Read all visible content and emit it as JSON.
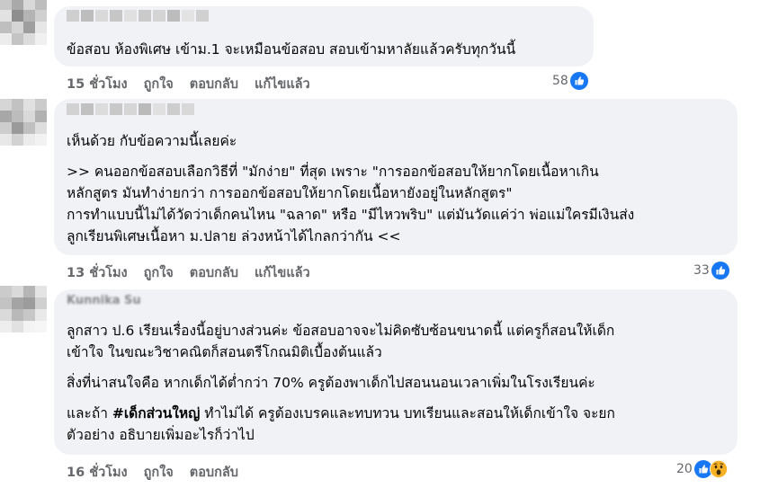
{
  "comments": [
    {
      "lines": [
        "ข้อสอบ ห้องพิเศษ เข้าม.1 จะเหมือนข้อสอบ สอบเข้ามหาลัยแล้วครับทุกวันนี้"
      ],
      "time": "15 ชั่วโมง",
      "like": "ถูกใจ",
      "reply": "ตอบกลับ",
      "edited": "แก้ไขแล้ว",
      "reaction_count": "58",
      "reaction_icons": [
        "like-icon"
      ]
    },
    {
      "lines": [
        "เห็นด้วย กับข้อความนี้เลยค่ะ",
        "",
        ">> คนออกข้อสอบเลือกวิธีที่ \"มักง่าย\" ที่สุด เพราะ \"การออกข้อสอบให้ยากโดยเนื้อหาเกิน",
        "หลักสูตร มันทำง่ายกว่า การออกข้อสอบให้ยากโดยเนื้อหายังอยู่ในหลักสูตร\"",
        "การทำแบบนี้ไม่ได้วัดว่าเด็กคนไหน \"ฉลาด\" หรือ \"มีไหวพริบ\" แต่มันวัดแค่ว่า พ่อแม่ใครมีเงินส่ง",
        "ลูกเรียนพิเศษเนื้อหา ม.ปลาย ล่วงหน้าได้ไกลกว่ากัน <<"
      ],
      "time": "13 ชั่วโมง",
      "like": "ถูกใจ",
      "reply": "ตอบกลับ",
      "edited": "แก้ไขแล้ว",
      "reaction_count": "33",
      "reaction_icons": [
        "like-icon"
      ]
    },
    {
      "author_peek": "Kunnika Su",
      "lines": [
        "ลูกสาว ป.6 เรียนเรื่องนี้อยู่บางส่วนค่ะ ข้อสอบอาจจะไม่คิดซับซ้อนขนาดนี้ แต่ครูก็สอนให้เด็ก",
        "เข้าใจ ในขณะวิชาคณิตก็สอนตรีโกณมิติเบื้องต้นแล้ว",
        "",
        "สิ่งที่น่าสนใจคือ หากเด็กได้ต่ำกว่า 70% ครูต้องพาเด็กไปสอนนอนเวลาเพิ่มในโรงเรียนค่ะ",
        "",
        "และถ้า",
        "ตัวอย่าง อธิบายเพิ่มอะไรก็ว่าไป"
      ],
      "bold_tag": "#เด็กส่วนใหญ่",
      "line5_rest": " ทำไม่ได้ ครูต้องเบรคและทบทวน บทเรียนและสอนให้เด็กเข้าใจ จะยก",
      "time": "16 ชั่วโมง",
      "like": "ถูกใจ",
      "reply": "ตอบกลับ",
      "reaction_count": "20",
      "reaction_icons": [
        "like-icon",
        "wow-icon"
      ]
    }
  ],
  "colors": {
    "bubble": "#f0f2f5",
    "meta_text": "#65676b",
    "like_blue": "#1877f2",
    "wow_yellow": "#f7b125"
  }
}
